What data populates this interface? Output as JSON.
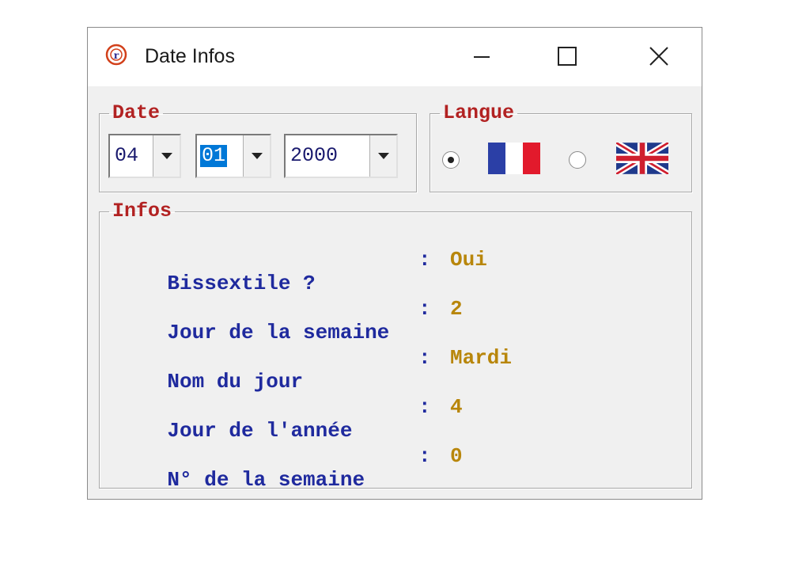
{
  "window": {
    "title": "Date Infos"
  },
  "date_group": {
    "legend": "Date",
    "day": "04",
    "month": "01",
    "year": "2000"
  },
  "lang_group": {
    "legend": "Langue",
    "selected": "fr",
    "options": [
      {
        "code": "fr",
        "icon": "french-flag-icon"
      },
      {
        "code": "en",
        "icon": "uk-flag-icon"
      }
    ]
  },
  "info_group": {
    "legend": "Infos",
    "separator": ":",
    "rows": [
      {
        "label": "Bissextile ?",
        "value": "Oui"
      },
      {
        "label": "Jour de la semaine",
        "value": "2"
      },
      {
        "label": "Nom du jour",
        "value": "Mardi"
      },
      {
        "label": "Jour de l'année",
        "value": "4"
      },
      {
        "label": "N° de la semaine",
        "value": "0"
      }
    ]
  },
  "colors": {
    "legend": "#b22222",
    "label": "#1f2a9e",
    "value": "#b8860b",
    "selection": "#0078d7"
  }
}
